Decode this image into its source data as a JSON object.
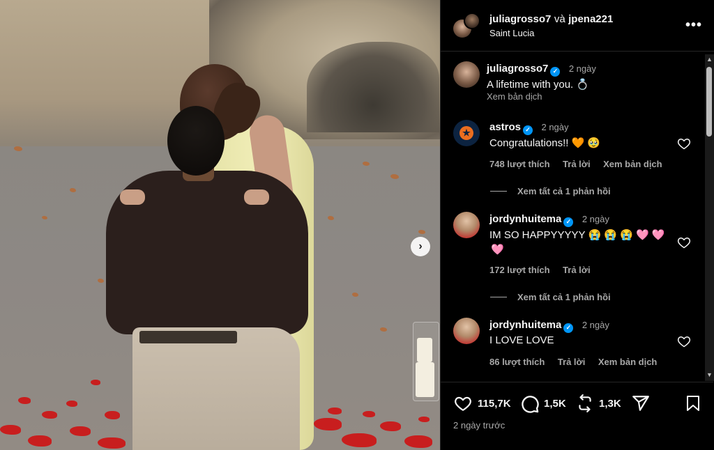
{
  "header": {
    "user1": "juliagrosso7",
    "conj": "và",
    "user2": "jpena221",
    "location": "Saint Lucia",
    "more_icon": "more-horizontal-icon"
  },
  "caption": {
    "username": "juliagrosso7",
    "time": "2 ngày",
    "text": "A lifetime with you. 💍",
    "translate": "Xem bản dịch"
  },
  "comments": [
    {
      "username": "astros",
      "time": "2 ngày",
      "text": "Congratulations!! 🧡 🥹",
      "likes": "748 lượt thích",
      "reply": "Trả lời",
      "translate": "Xem bản dịch",
      "view_replies": "Xem tất cả 1 phản hồi"
    },
    {
      "username": "jordynhuitema",
      "time": "2 ngày",
      "text_line1": "IM SO HAPPYYYYY 😭 😭 😭 🩷 🩷",
      "text_line2": "🩷",
      "likes": "172 lượt thích",
      "reply": "Trả lời",
      "view_replies": "Xem tất cả 1 phản hồi"
    },
    {
      "username": "jordynhuitema",
      "time": "2 ngày",
      "text": "I LOVE LOVE",
      "likes": "86 lượt thích",
      "reply": "Trả lời",
      "translate": "Xem bản dịch"
    }
  ],
  "actions": {
    "likes": "115,7K",
    "comments": "1,5K",
    "reposts": "1,3K",
    "posted": "2 ngày trước"
  },
  "colors": {
    "background": "#000000",
    "verified": "#0095f6",
    "meta_text": "#a8a8a8",
    "astros_navy": "#0c2340",
    "astros_orange": "#eb6e1f"
  }
}
